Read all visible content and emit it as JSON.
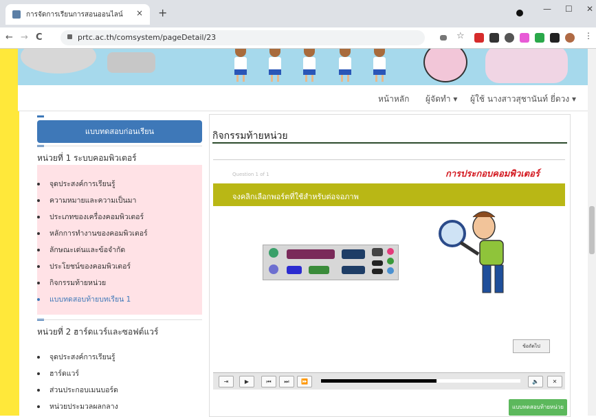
{
  "browser": {
    "tab_title": "การจัดการเรียนการสอนออนไลน์",
    "tab_close": "×",
    "new_tab": "+",
    "url": "prtc.ac.th/comsystem/pageDetail/23",
    "win_minimize": "—",
    "win_maximize": "☐",
    "win_close": "✕",
    "back": "←",
    "forward": "→",
    "reload": "C"
  },
  "navbar": {
    "home": "หน้าหลัก",
    "author": "ผู้จัดทำ ▾",
    "user": "ผู้ใช้ นางสาวสุชานันท์ ยี่ดวง ▾"
  },
  "sidebar": {
    "pretest_button": "แบบทดสอบก่อนเรียน",
    "unit1": {
      "title": "หน่วยที่ 1 ระบบคอมพิวเตอร์",
      "items": [
        "จุดประสงค์การเรียนรู้",
        "ความหมายและความเป็นมา",
        "ประเภทของเครื่องคอมพิวเตอร์",
        "หลักการทำงานของคอมพิวเตอร์",
        "ลักษณะเด่นและข้อจำกัด",
        "ประโยชน์ของคอมพิวเตอร์",
        "กิจกรรมท้ายหน่วย",
        "แบบทดสอบท้ายบทเรียน 1"
      ]
    },
    "unit2": {
      "title": "หน่วยที่ 2 ฮาร์ดแวร์และซอฟต์แวร์",
      "items": [
        "จุดประสงค์การเรียนรู้",
        "ฮาร์ดแวร์",
        "ส่วนประกอบเมนบอร์ด",
        "หน่วยประมวลผลกลาง"
      ]
    }
  },
  "content": {
    "title": "กิจกรรมท้ายหน่วย",
    "quiz": {
      "question_counter": "Question 1 of 1",
      "heading": "การประกอบคอมพิวเตอร์",
      "instruction": "จงคลิกเลือกพอร์ตที่ใช้สำหรับต่อจอภาพ",
      "next_button": "ข้อถัดไป",
      "progress": 0.58
    },
    "posttest_button": "แบบทดสอบท้ายหน่วย"
  },
  "colors": {
    "accent_blue": "#3e78b8",
    "olive_bar": "#b9b715",
    "quiz_red": "#d3181f",
    "green_button": "#5cb85c",
    "pink_box": "#ffe2e6"
  }
}
